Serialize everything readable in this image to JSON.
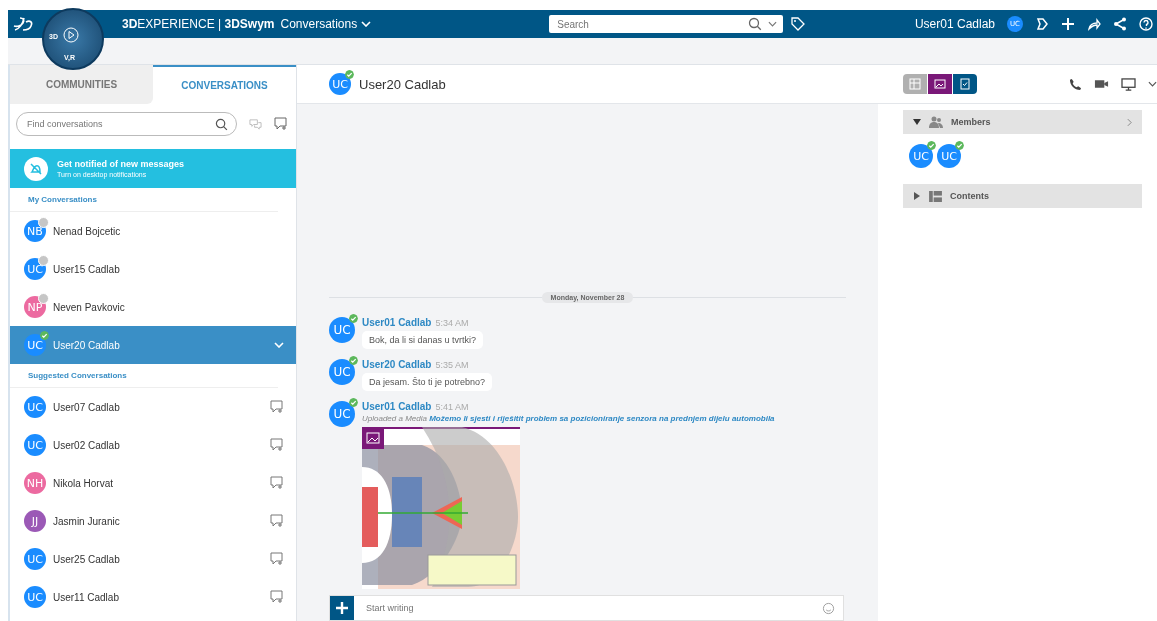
{
  "topbar": {
    "brand": "**3D**EXPERIENCE | **3DSwym**",
    "section": "Conversations",
    "compass_labels": [
      "3D",
      "V,R"
    ],
    "search_placeholder": "Search",
    "user_name": "User01 Cadlab",
    "user_initials": "UC"
  },
  "sidebar": {
    "tabs": [
      {
        "label": "COMMUNITIES",
        "selected": false
      },
      {
        "label": "CONVERSATIONS",
        "selected": true
      }
    ],
    "search_placeholder": "Find conversations",
    "notification": {
      "title": "Get notified of new messages",
      "subtitle": "Turn on desktop notifications"
    },
    "sections": [
      {
        "title": "My Conversations",
        "kind": "mine",
        "items": [
          {
            "initials": "NB",
            "name": "Nenad Bojcetic",
            "color": "#1a8cff",
            "online": false,
            "selected": false
          },
          {
            "initials": "UC",
            "name": "User15 Cadlab",
            "color": "#1a8cff",
            "online": false,
            "selected": false
          },
          {
            "initials": "NP",
            "name": "Neven Pavkovic",
            "color": "#ec6aa0",
            "online": false,
            "selected": false
          },
          {
            "initials": "UC",
            "name": "User20 Cadlab",
            "color": "#1a8cff",
            "online": true,
            "selected": true
          }
        ]
      },
      {
        "title": "Suggested Conversations",
        "kind": "suggested",
        "items": [
          {
            "initials": "UC",
            "name": "User07 Cadlab",
            "color": "#1a8cff",
            "selected": false
          },
          {
            "initials": "UC",
            "name": "User02 Cadlab",
            "color": "#1a8cff",
            "selected": false
          },
          {
            "initials": "NH",
            "name": "Nikola Horvat",
            "color": "#ec6aa0",
            "selected": false
          },
          {
            "initials": "JJ",
            "name": "Jasmin Juranic",
            "color": "#9b59b6",
            "selected": false
          },
          {
            "initials": "UC",
            "name": "User25 Cadlab",
            "color": "#1a8cff",
            "selected": false
          },
          {
            "initials": "UC",
            "name": "User11 Cadlab",
            "color": "#1a8cff",
            "selected": false
          }
        ]
      }
    ]
  },
  "chat": {
    "header": {
      "initials": "UC",
      "name": "User20 Cadlab",
      "online": true
    },
    "date": "Monday, November 28",
    "messages": [
      {
        "kind": "text",
        "initials": "UC",
        "name": "User01 Cadlab",
        "time": "5:34 AM",
        "online": true,
        "text": "Bok, da li si danas u tvrtki?"
      },
      {
        "kind": "text",
        "initials": "UC",
        "name": "User20 Cadlab",
        "time": "5:35 AM",
        "online": true,
        "text": "Da jesam. Što ti je potrebno?"
      },
      {
        "kind": "media",
        "initials": "UC",
        "name": "User01 Cadlab",
        "time": "5:41 AM",
        "online": true,
        "action": "Uploaded a Media",
        "caption": "Možemo li sjesti i riješitit problem sa pozicioniranje senzora na prednjem dijelu automobila"
      }
    ],
    "composer_placeholder": "Start writing"
  },
  "info": {
    "panels": [
      {
        "title": "Members",
        "expanded": true,
        "members": [
          {
            "initials": "UC",
            "online": true
          },
          {
            "initials": "UC",
            "online": true
          }
        ]
      },
      {
        "title": "Contents",
        "expanded": false
      }
    ]
  }
}
